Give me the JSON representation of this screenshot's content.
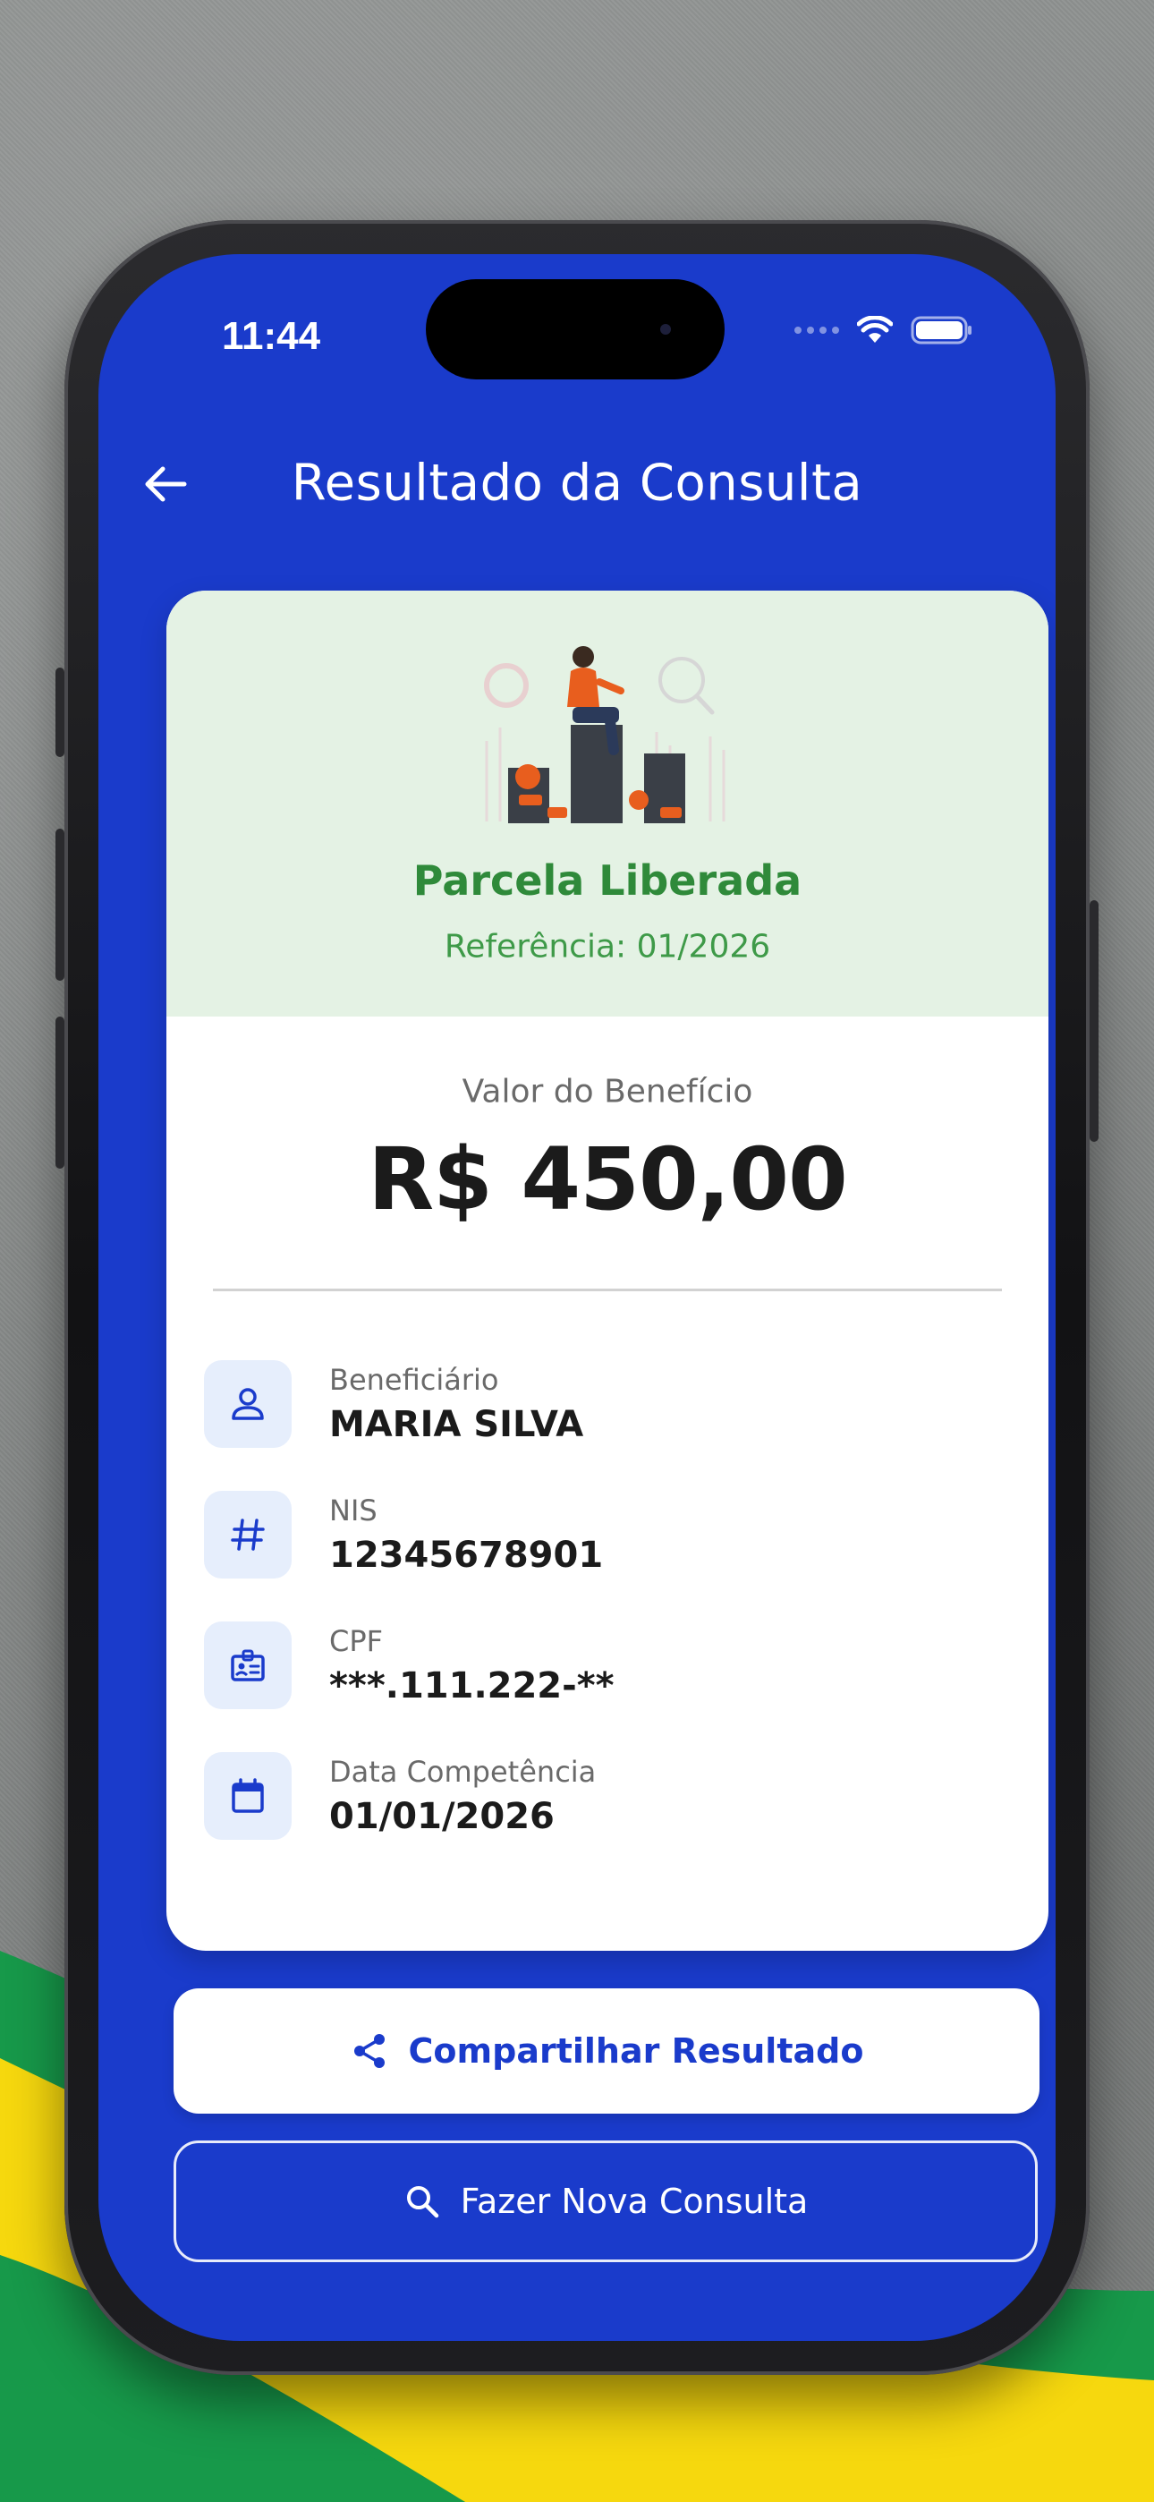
{
  "status_bar": {
    "time": "11:44",
    "icons": [
      "signal-dots",
      "wifi-icon",
      "battery-icon"
    ]
  },
  "header": {
    "back_icon": "arrow-left-icon",
    "title": "Resultado da Consulta"
  },
  "result_card": {
    "status": {
      "title": "Parcela Liberada",
      "reference": "Referência: 01/2026",
      "color": "#2f8a3a",
      "background": "#e4f2e4"
    },
    "value": {
      "label": "Valor do Benefício",
      "amount": "R$ 450,00"
    },
    "details": [
      {
        "icon": "user-icon",
        "label": "Beneficiário",
        "value": "MARIA SILVA"
      },
      {
        "icon": "hash-icon",
        "label": "NIS",
        "value": "12345678901"
      },
      {
        "icon": "id-card-icon",
        "label": "CPF",
        "value": "***.111.222-**"
      },
      {
        "icon": "calendar-icon",
        "label": "Data Competência",
        "value": "01/01/2026"
      }
    ]
  },
  "actions": {
    "share_label": "Compartilhar Resultado",
    "share_icon": "share-icon",
    "new_query_label": "Fazer Nova Consulta",
    "new_query_icon": "search-icon"
  },
  "theme": {
    "primary": "#1a3bcb",
    "card_icon_bg": "#e6eefc"
  }
}
